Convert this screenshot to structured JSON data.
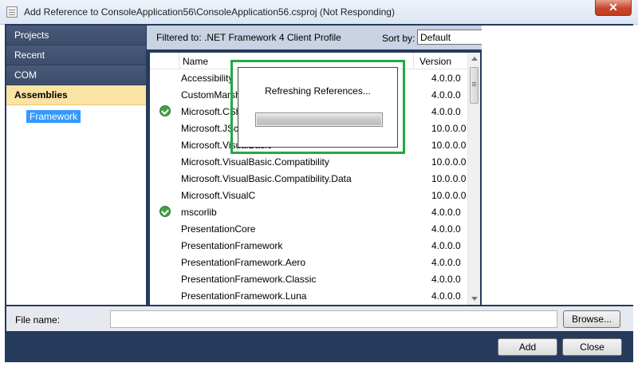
{
  "window": {
    "title": "Add Reference to ConsoleApplication56\\ConsoleApplication56.csproj (Not Responding)",
    "close_glyph": "✕"
  },
  "sidebar": {
    "items": [
      {
        "label": "Projects"
      },
      {
        "label": "Recent"
      },
      {
        "label": "COM"
      },
      {
        "label": "Assemblies"
      }
    ],
    "sub_item": "Framework"
  },
  "header": {
    "filter_text": "Filtered to: .NET Framework 4 Client Profile",
    "sort_label": "Sort by:",
    "sort_value": "Default"
  },
  "list": {
    "col_name": "Name",
    "col_version": "Version",
    "rows": [
      {
        "name": "Accessibility",
        "version": "4.0.0.0",
        "checked": false
      },
      {
        "name": "CustomMarsh",
        "version": "4.0.0.0",
        "checked": false
      },
      {
        "name": "Microsoft.CSh",
        "version": "4.0.0.0",
        "checked": true
      },
      {
        "name": "Microsoft.JScr",
        "version": "10.0.0.0",
        "checked": false
      },
      {
        "name": "Microsoft.VisualBasic",
        "version": "10.0.0.0",
        "checked": false
      },
      {
        "name": "Microsoft.VisualBasic.Compatibility",
        "version": "10.0.0.0",
        "checked": false
      },
      {
        "name": "Microsoft.VisualBasic.Compatibility.Data",
        "version": "10.0.0.0",
        "checked": false
      },
      {
        "name": "Microsoft.VisualC",
        "version": "10.0.0.0",
        "checked": false
      },
      {
        "name": "mscorlib",
        "version": "4.0.0.0",
        "checked": true
      },
      {
        "name": "PresentationCore",
        "version": "4.0.0.0",
        "checked": false
      },
      {
        "name": "PresentationFramework",
        "version": "4.0.0.0",
        "checked": false
      },
      {
        "name": "PresentationFramework.Aero",
        "version": "4.0.0.0",
        "checked": false
      },
      {
        "name": "PresentationFramework.Classic",
        "version": "4.0.0.0",
        "checked": false
      },
      {
        "name": "PresentationFramework.Luna",
        "version": "4.0.0.0",
        "checked": false
      }
    ]
  },
  "popup": {
    "message": "Refreshing References...",
    "progress": 1.0
  },
  "footer": {
    "file_label": "File name:",
    "file_value": "",
    "browse_label": "Browse...",
    "add_label": "Add",
    "close_label": "Close"
  },
  "colors": {
    "frame": "#263a5c",
    "nav": "#3c4d6b",
    "nav_active": "#fbe3a4",
    "selection": "#3399ff",
    "highlight": "#22aa44",
    "check": "#43a047"
  }
}
